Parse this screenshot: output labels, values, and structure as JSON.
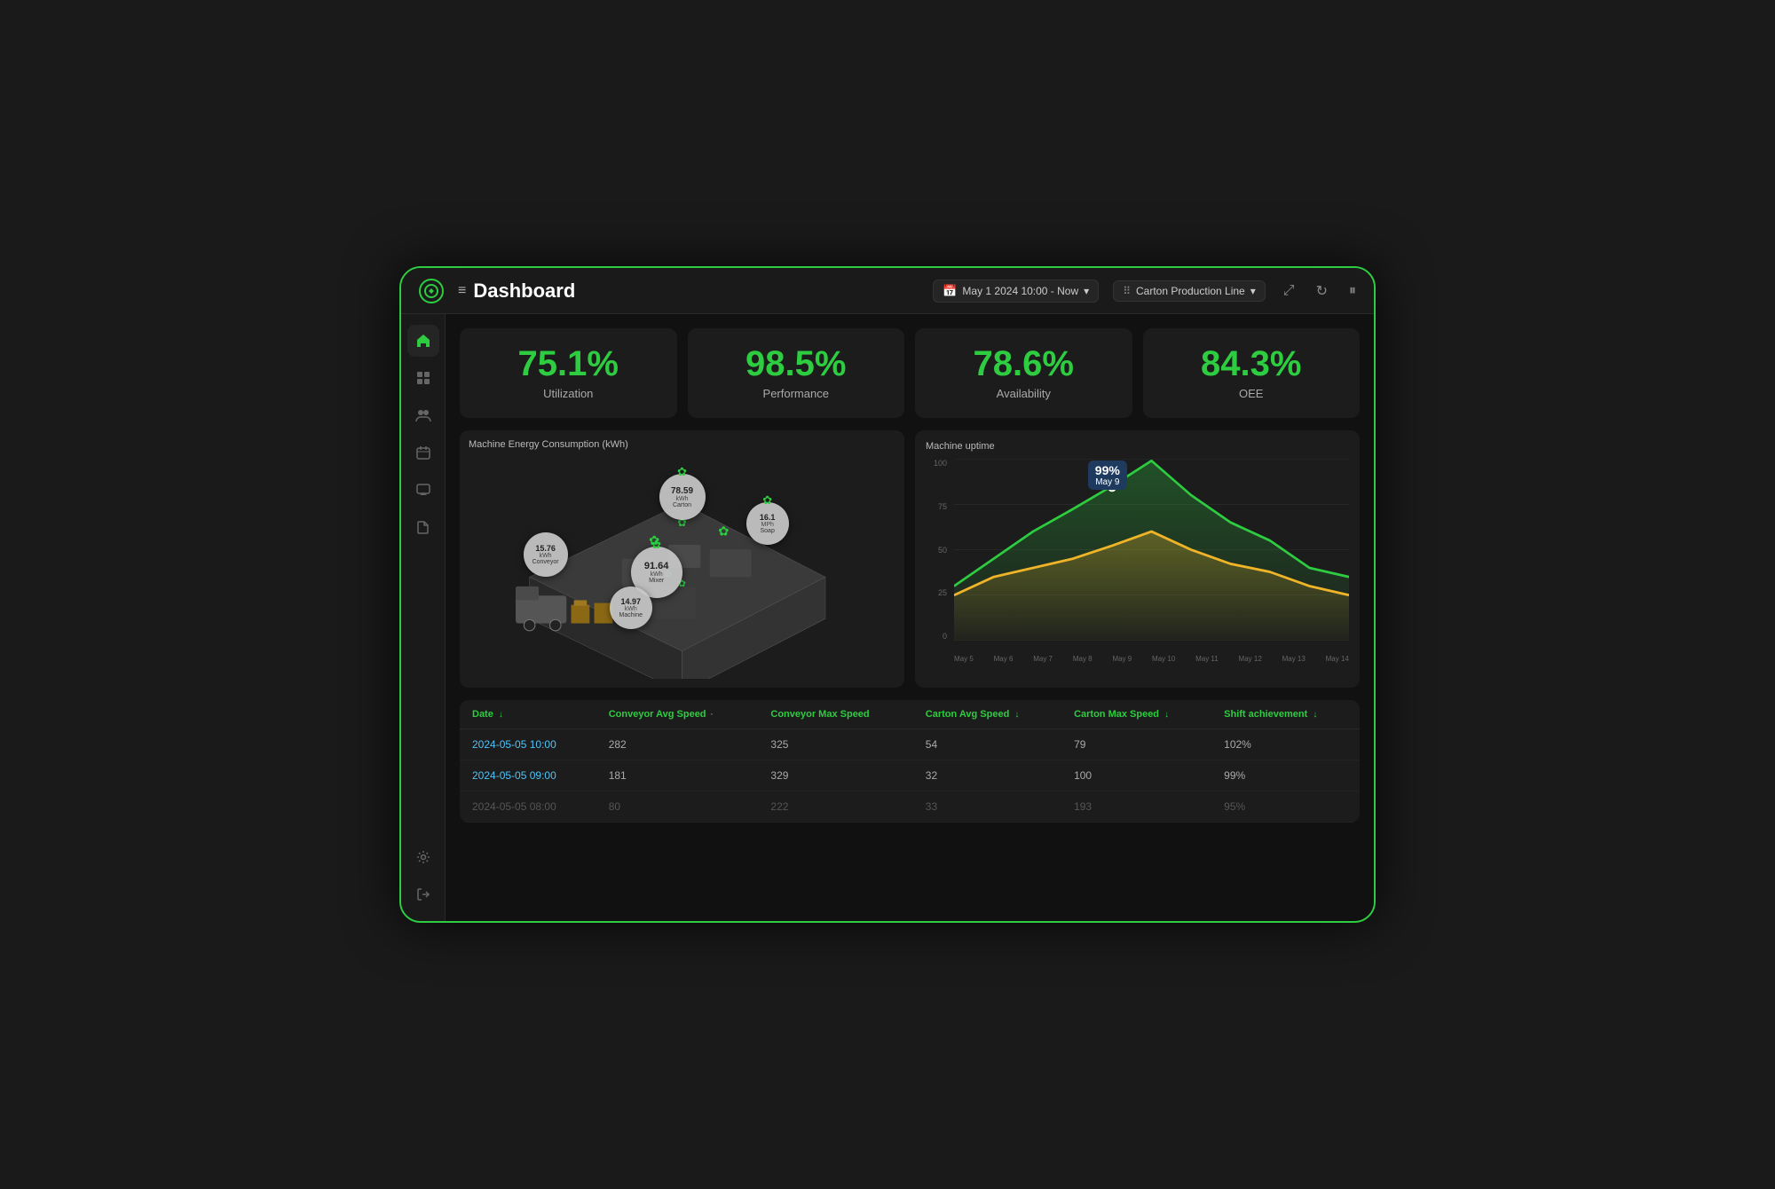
{
  "nav": {
    "title": "Dashboard",
    "date_range": "May 1 2024 10:00 - Now",
    "production_line": "Carton Production Line",
    "hamburger": "≡"
  },
  "kpis": [
    {
      "value": "75.1",
      "unit": "%",
      "label": "Utilization"
    },
    {
      "value": "98.5",
      "unit": "%",
      "label": "Performance"
    },
    {
      "value": "78.6",
      "unit": "%",
      "label": "Availability"
    },
    {
      "value": "84.3",
      "unit": "%",
      "label": "OEE"
    }
  ],
  "energy_chart": {
    "title": "Machine Energy Consumption (kWh)",
    "machines": [
      {
        "id": "carton",
        "label": "Carton",
        "value": "78.59",
        "unit": "kWh",
        "top": "20%",
        "left": "52%",
        "size": 52
      },
      {
        "id": "mixer",
        "label": "Mixer",
        "value": "91.64",
        "unit": "kWh",
        "top": "48%",
        "left": "46%",
        "size": 56
      },
      {
        "id": "conveyor",
        "label": "Conveyor",
        "value": "15.76",
        "unit": "kWh",
        "top": "42%",
        "left": "20%",
        "size": 48
      },
      {
        "id": "soap",
        "label": "Soap",
        "value": "16.1",
        "unit": "MPh",
        "top": "30%",
        "left": "68%",
        "size": 46
      },
      {
        "id": "machine",
        "label": "Machine",
        "value": "14.97",
        "unit": "kWh",
        "top": "64%",
        "left": "38%",
        "size": 46
      }
    ]
  },
  "uptime_chart": {
    "title": "Machine uptime",
    "x_labels": [
      "May 5",
      "May 6",
      "May 7",
      "May 8",
      "May 9",
      "May 10",
      "May 11",
      "May 12",
      "May 13",
      "May 14"
    ],
    "y_labels": [
      "100",
      "75",
      "50",
      "25",
      "0"
    ],
    "tooltip": {
      "value": "99%",
      "date": "May 9"
    },
    "green_line": [
      30,
      45,
      60,
      72,
      85,
      99,
      80,
      65,
      55,
      40,
      35
    ],
    "yellow_line": [
      25,
      35,
      40,
      45,
      52,
      60,
      50,
      42,
      38,
      30,
      25
    ]
  },
  "table": {
    "columns": [
      {
        "label": "Date",
        "sort": true
      },
      {
        "label": "Conveyor Avg Speed",
        "sort": false
      },
      {
        "label": "Conveyor Max Speed",
        "sort": false
      },
      {
        "label": "Carton Avg Speed",
        "sort": true
      },
      {
        "label": "Carton Max Speed",
        "sort": true
      },
      {
        "label": "Shift achievement",
        "sort": true
      }
    ],
    "rows": [
      {
        "date": "2024-05-05 10:00",
        "conv_avg": "282",
        "conv_max": "325",
        "cart_avg": "54",
        "cart_max": "79",
        "shift": "102%"
      },
      {
        "date": "2024-05-05 09:00",
        "conv_avg": "181",
        "conv_max": "329",
        "cart_avg": "32",
        "cart_max": "100",
        "shift": "99%"
      },
      {
        "date": "2024-05-05 08:00",
        "conv_avg": "80",
        "conv_max": "222",
        "cart_avg": "33",
        "cart_max": "193",
        "shift": "95%"
      }
    ]
  },
  "sidebar": {
    "items": [
      {
        "icon": "⌂",
        "name": "home",
        "active": true
      },
      {
        "icon": "⊞",
        "name": "grid"
      },
      {
        "icon": "👥",
        "name": "users"
      },
      {
        "icon": "📅",
        "name": "calendar"
      },
      {
        "icon": "💬",
        "name": "messages"
      },
      {
        "icon": "📁",
        "name": "files"
      }
    ],
    "bottom_items": [
      {
        "icon": "⚙",
        "name": "settings"
      },
      {
        "icon": "→",
        "name": "logout"
      }
    ]
  },
  "colors": {
    "accent": "#2ecc40",
    "blue_link": "#4fc3f7",
    "bg_dark": "#111111",
    "bg_card": "#1c1c1c",
    "text_muted": "#aaaaaa"
  }
}
